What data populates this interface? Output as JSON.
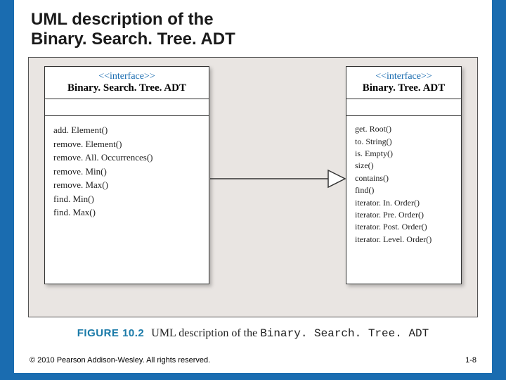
{
  "title_line1": "UML description of the",
  "title_line2": "Binary. Search. Tree. ADT",
  "left": {
    "stereotype": "<<interface>>",
    "name": "Binary. Search. Tree. ADT",
    "ops": [
      "add. Element()",
      "remove. Element()",
      "remove. All. Occurrences()",
      "remove. Min()",
      "remove. Max()",
      "find. Min()",
      "find. Max()"
    ]
  },
  "right": {
    "stereotype": "<<interface>>",
    "name": "Binary. Tree. ADT",
    "ops": [
      "get. Root()",
      "to. String()",
      "is. Empty()",
      "size()",
      "contains()",
      "find()",
      "iterator. In. Order()",
      "iterator. Pre. Order()",
      "iterator. Post. Order()",
      "iterator. Level. Order()"
    ]
  },
  "caption": {
    "fignum": "FIGURE 10.2",
    "text": "UML description of the",
    "mono": "Binary. Search. Tree. ADT"
  },
  "footer": {
    "copyright": "© 2010 Pearson Addison-Wesley. All rights reserved.",
    "page": "1-8"
  }
}
